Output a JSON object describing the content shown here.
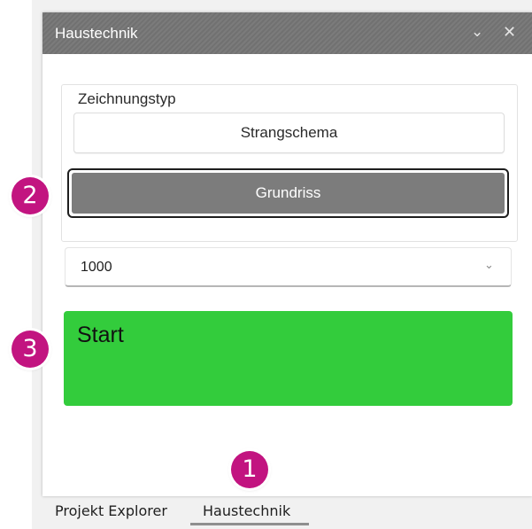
{
  "window": {
    "title": "Haustechnik",
    "chevron_icon": "chevron-down-icon",
    "close_icon": "close-icon"
  },
  "drawing_type": {
    "legend": "Zeichnungstyp",
    "options": [
      {
        "label": "Strangschema",
        "selected": false
      },
      {
        "label": "Grundriss",
        "selected": true
      }
    ]
  },
  "scale_select": {
    "value": "1000"
  },
  "start_button": {
    "label": "Start",
    "color": "#33cc3c"
  },
  "bottom_tabs": [
    {
      "label": "Projekt Explorer",
      "active": false
    },
    {
      "label": "Haustechnik",
      "active": true
    }
  ],
  "annotations": {
    "badge_color": "#c21480",
    "markers": [
      "1",
      "2",
      "3"
    ]
  }
}
